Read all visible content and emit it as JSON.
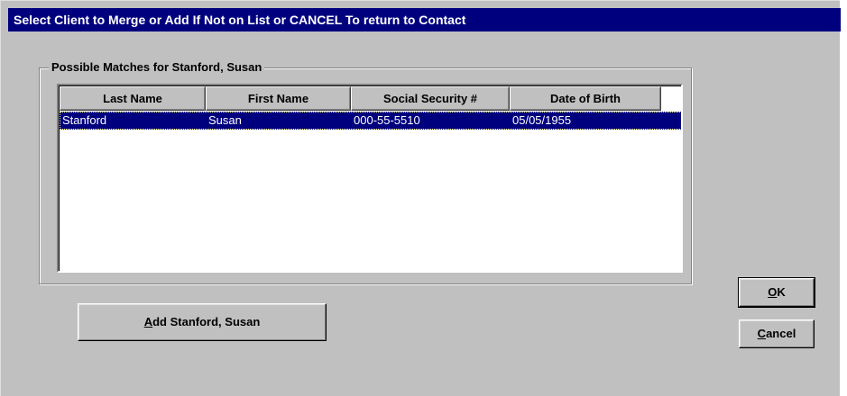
{
  "window": {
    "title": "Select Client to Merge or Add If Not on List or CANCEL To return to Contact"
  },
  "group": {
    "label": "Possible Matches for Stanford, Susan"
  },
  "table": {
    "columns": [
      "Last Name",
      "First Name",
      "Social Security #",
      "Date of Birth"
    ],
    "rows": [
      {
        "last_name": "Stanford",
        "first_name": "Susan",
        "ssn": "000-55-5510",
        "dob": "05/05/1955",
        "selected": true
      }
    ]
  },
  "buttons": {
    "add": {
      "mnemonic": "A",
      "rest": "dd Stanford, Susan"
    },
    "ok": {
      "mnemonic": "O",
      "rest": "K"
    },
    "cancel": {
      "mnemonic": "C",
      "rest": "ancel"
    }
  },
  "colors": {
    "title_bar": "#00007f",
    "face": "#c0c0c0",
    "selection": "#00007f"
  }
}
